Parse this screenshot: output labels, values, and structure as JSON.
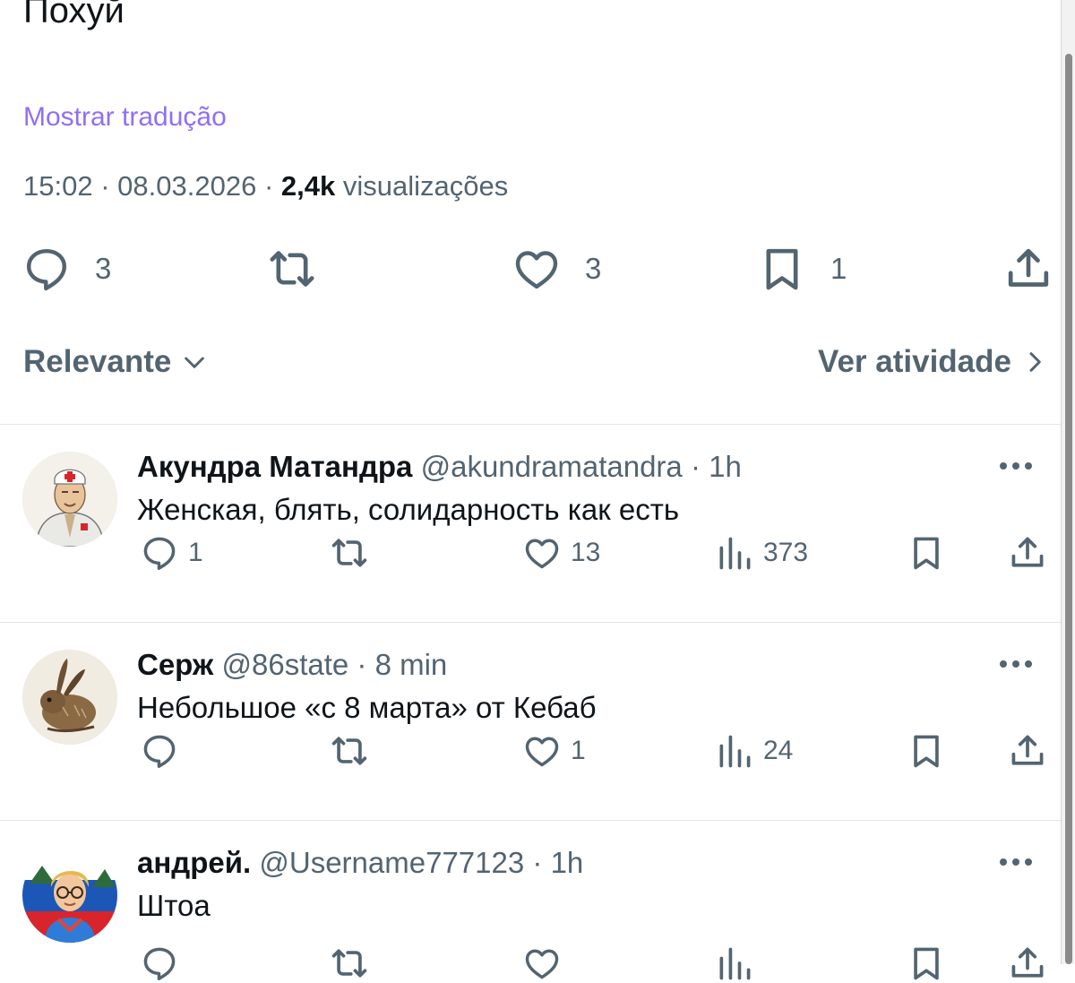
{
  "post": {
    "text": "Похуй",
    "show_translation": "Mostrar tradução",
    "time": "15:02",
    "date": "08.03.2026",
    "views_count": "2,4k",
    "views_label": "visualizações",
    "replies": "3",
    "likes": "3",
    "bookmarks": "1"
  },
  "sort": {
    "label": "Relevante",
    "activity": "Ver atividade"
  },
  "replies": [
    {
      "name": "Акундра Матандра",
      "handle": "@akundramatandra",
      "time": "1h",
      "text": "Женская, блять, солидарность как есть",
      "reply_count": "1",
      "retweet_count": "",
      "like_count": "13",
      "view_count": "373"
    },
    {
      "name": "Серж",
      "handle": "@86state",
      "time": "8 min",
      "text": "Небольшое «с 8 марта» от Кебаб",
      "reply_count": "",
      "retweet_count": "",
      "like_count": "1",
      "view_count": "24"
    },
    {
      "name": "андрей.",
      "handle": "@Username777123",
      "time": "1h",
      "text": "Штоа"
    }
  ],
  "separator": "·",
  "colors": {
    "link": "#8f6ff5",
    "muted": "#536471",
    "text": "#0f1419",
    "divider": "#e1e6ea"
  }
}
